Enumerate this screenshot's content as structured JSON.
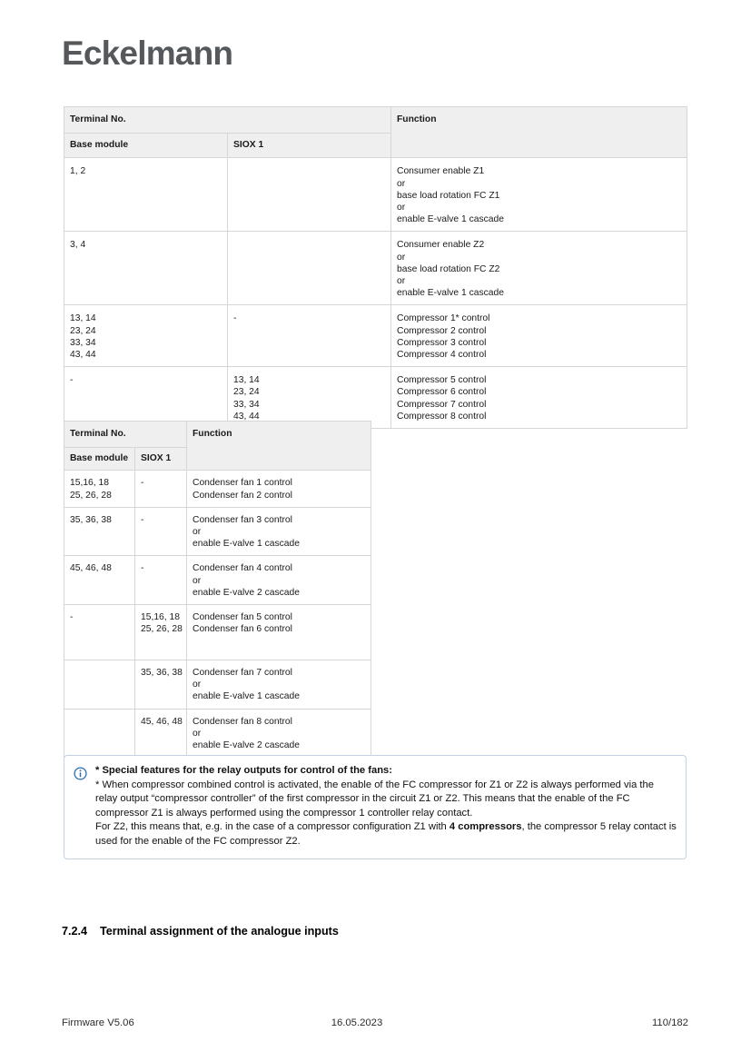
{
  "brand": {
    "logo_text": "Eckelmann"
  },
  "table1": {
    "header_top": {
      "terminal_no": "Terminal No.",
      "function": "Function"
    },
    "header_sub": {
      "base_module": "Base module",
      "siox1": "SIOX 1"
    },
    "rows": [
      {
        "base_module": [
          "1, 2"
        ],
        "siox1": [
          ""
        ],
        "function": [
          "Consumer enable Z1",
          "or",
          "base load rotation FC Z1",
          "or",
          "enable E-valve 1 cascade"
        ]
      },
      {
        "base_module": [
          "3, 4"
        ],
        "siox1": [
          ""
        ],
        "function": [
          "Consumer enable Z2",
          "or",
          "base load rotation FC Z2",
          "or",
          "enable E-valve 1 cascade"
        ]
      },
      {
        "base_module": [
          "13, 14",
          "23, 24",
          "33, 34",
          "43, 44"
        ],
        "siox1": [
          "-"
        ],
        "function": [
          "Compressor 1* control",
          "Compressor 2 control",
          "Compressor 3 control",
          "Compressor 4 control"
        ]
      },
      {
        "base_module": [
          "-"
        ],
        "siox1": [
          "13, 14",
          "23, 24",
          "33, 34",
          "43, 44"
        ],
        "function": [
          "Compressor 5 control",
          "Compressor 6 control",
          "Compressor 7 control",
          "Compressor 8 control"
        ]
      }
    ]
  },
  "table2": {
    "header_top": {
      "terminal_no": "Terminal No.",
      "function": "Function"
    },
    "header_sub": {
      "base_module": "Base module",
      "siox1": "SIOX 1"
    },
    "rows": [
      {
        "base_module": [
          "15,16, 18",
          "25, 26, 28"
        ],
        "siox1": [
          "-"
        ],
        "function": [
          "Condenser fan 1 control",
          "Condenser fan 2 control"
        ]
      },
      {
        "base_module": [
          "35, 36, 38"
        ],
        "siox1": [
          "-"
        ],
        "function": [
          "Condenser fan 3 control",
          "or",
          "enable E-valve 1 cascade"
        ]
      },
      {
        "base_module": [
          "45, 46, 48"
        ],
        "siox1": [
          "-"
        ],
        "function": [
          "Condenser fan 4 control",
          "or",
          "enable E-valve 2 cascade"
        ]
      },
      {
        "base_module": [
          "-"
        ],
        "siox1": [
          "15,16, 18",
          "25, 26, 28"
        ],
        "function": [
          "Condenser fan 5 control",
          "Condenser fan 6 control"
        ]
      },
      {
        "base_module": [
          ""
        ],
        "siox1": [
          "35, 36, 38"
        ],
        "function": [
          "Condenser fan 7 control",
          "or",
          "enable E-valve 1 cascade"
        ]
      },
      {
        "base_module": [
          ""
        ],
        "siox1": [
          "45, 46, 48"
        ],
        "function": [
          "Condenser fan 8 control",
          "or",
          "enable E-valve 2 cascade"
        ]
      }
    ]
  },
  "note": {
    "icon": "info-circle-icon",
    "icon_color": "#2a6ebb",
    "border_color": "#c3d2e0",
    "title": "* Special features for the relay outputs for control of the fans:",
    "paragraph1_a": "* When compressor combined control is activated, the enable of the FC compressor for Z1 or Z2 is always performed via the relay output “compressor controller” of the first compressor in the circuit Z1 or Z2. This means that the enable of the FC compressor Z1 is always performed using the compressor 1 controller relay contact.",
    "paragraph2_a": "For Z2, this means that, e.g. in the case of a compressor configuration Z1 with ",
    "paragraph2_bold": "4 compressors",
    "paragraph2_b": ", the compressor 5 relay contact is used for the enable of the FC compressor Z2."
  },
  "section": {
    "number": "7.2.4",
    "title": "Terminal assignment of the analogue inputs"
  },
  "footer": {
    "firmware": "Firmware V5.06",
    "date": "16.05.2023",
    "page": "110/182"
  }
}
